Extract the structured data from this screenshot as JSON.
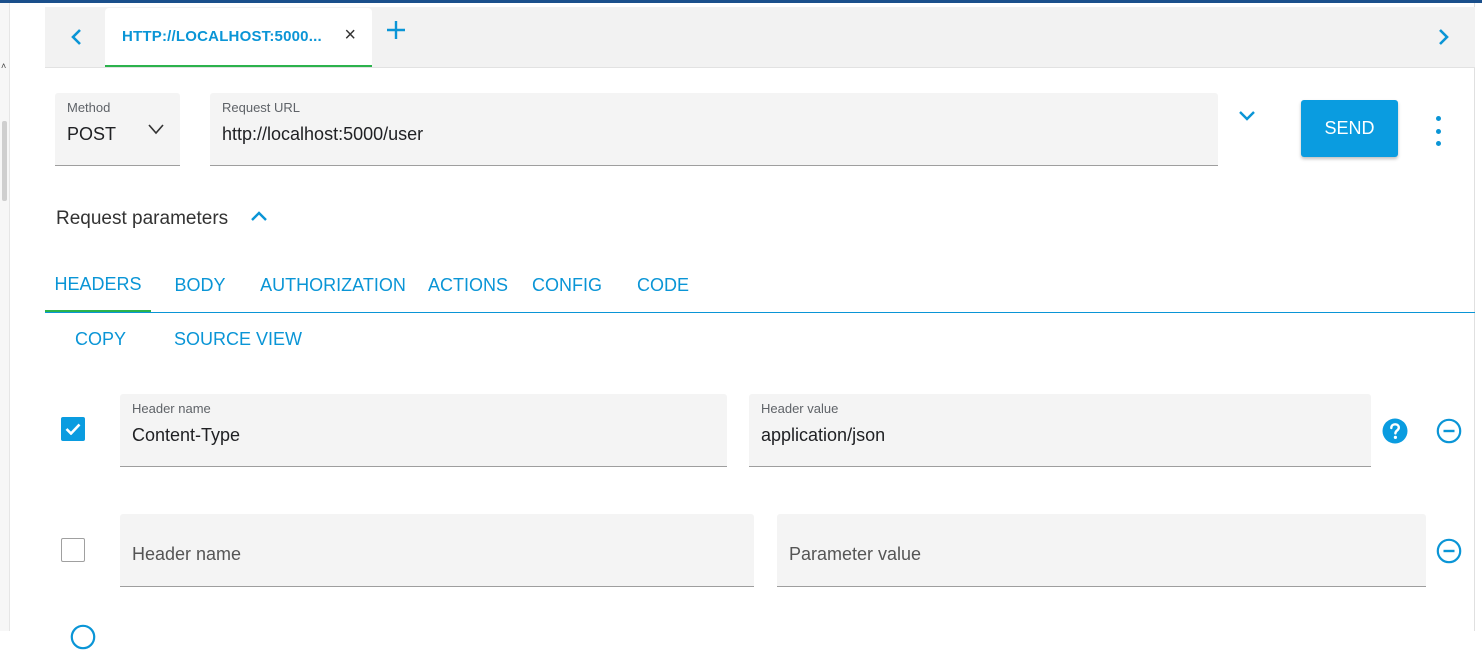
{
  "tabbar": {
    "tab_label": "HTTP://LOCALHOST:5000...",
    "close_glyph": "×",
    "add_glyph": "+",
    "left_glyph": "‹",
    "right_glyph": "›"
  },
  "request": {
    "method_label": "Method",
    "method_value": "POST",
    "url_label": "Request URL",
    "url_value": "http://localhost:5000/user",
    "send_label": "SEND"
  },
  "params": {
    "title": "Request parameters",
    "tabs": [
      {
        "label": "HEADERS",
        "active": true
      },
      {
        "label": "BODY",
        "active": false
      },
      {
        "label": "AUTHORIZATION",
        "active": false
      },
      {
        "label": "ACTIONS",
        "active": false
      },
      {
        "label": "CONFIG",
        "active": false
      },
      {
        "label": "CODE",
        "active": false
      }
    ],
    "actions": {
      "copy": "COPY",
      "source_view": "SOURCE VIEW"
    }
  },
  "headers": [
    {
      "enabled": true,
      "name_label": "Header name",
      "name_value": "Content-Type",
      "value_label": "Header value",
      "value_value": "application/json"
    },
    {
      "enabled": false,
      "name_placeholder": "Header name",
      "value_placeholder": "Parameter value"
    }
  ],
  "colors": {
    "accent": "#0a95d6",
    "send_button": "#0a9ce0",
    "active_tab_underline": "#2bb24c"
  },
  "icons": [
    "chevron-left-icon",
    "chevron-right-icon",
    "close-icon",
    "plus-icon",
    "chevron-down-icon",
    "more-vert-icon",
    "chevron-up-icon",
    "check-icon",
    "help-icon",
    "remove-circle-icon"
  ]
}
